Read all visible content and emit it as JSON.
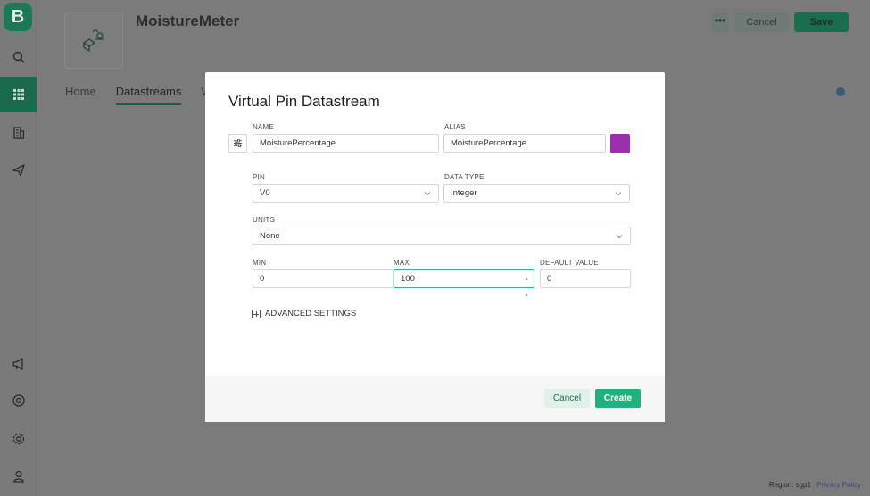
{
  "sidebar": {
    "logo_letter": "B",
    "items": [
      {
        "icon": "search-icon"
      },
      {
        "icon": "grid-icon",
        "active": true
      },
      {
        "icon": "building-icon"
      },
      {
        "icon": "send-icon"
      },
      {
        "icon": "megaphone-icon"
      },
      {
        "icon": "lifebuoy-icon"
      },
      {
        "icon": "gear-icon"
      },
      {
        "icon": "user-icon"
      }
    ]
  },
  "header": {
    "title": "MoistureMeter",
    "more_label": "•••",
    "cancel_label": "Cancel",
    "save_label": "Save"
  },
  "tabs": [
    {
      "label": "Home"
    },
    {
      "label": "Datastreams",
      "active": true
    },
    {
      "label": "We"
    }
  ],
  "footer": {
    "region": "Region: sgp1",
    "privacy": "Privacy Policy"
  },
  "modal": {
    "title": "Virtual Pin Datastream",
    "name": {
      "label": "NAME",
      "value": "MoisturePercentage"
    },
    "alias": {
      "label": "ALIAS",
      "value": "MoisturePercentage"
    },
    "color": "#9b2fae",
    "pin": {
      "label": "PIN",
      "value": "V0"
    },
    "data_type": {
      "label": "DATA TYPE",
      "value": "Integer"
    },
    "units": {
      "label": "UNITS",
      "value": "None"
    },
    "min": {
      "label": "MIN",
      "value": "0"
    },
    "max": {
      "label": "MAX",
      "value": "100"
    },
    "default_value": {
      "label": "DEFAULT VALUE",
      "value": "0"
    },
    "advanced_label": "ADVANCED SETTINGS",
    "cancel_label": "Cancel",
    "create_label": "Create"
  }
}
